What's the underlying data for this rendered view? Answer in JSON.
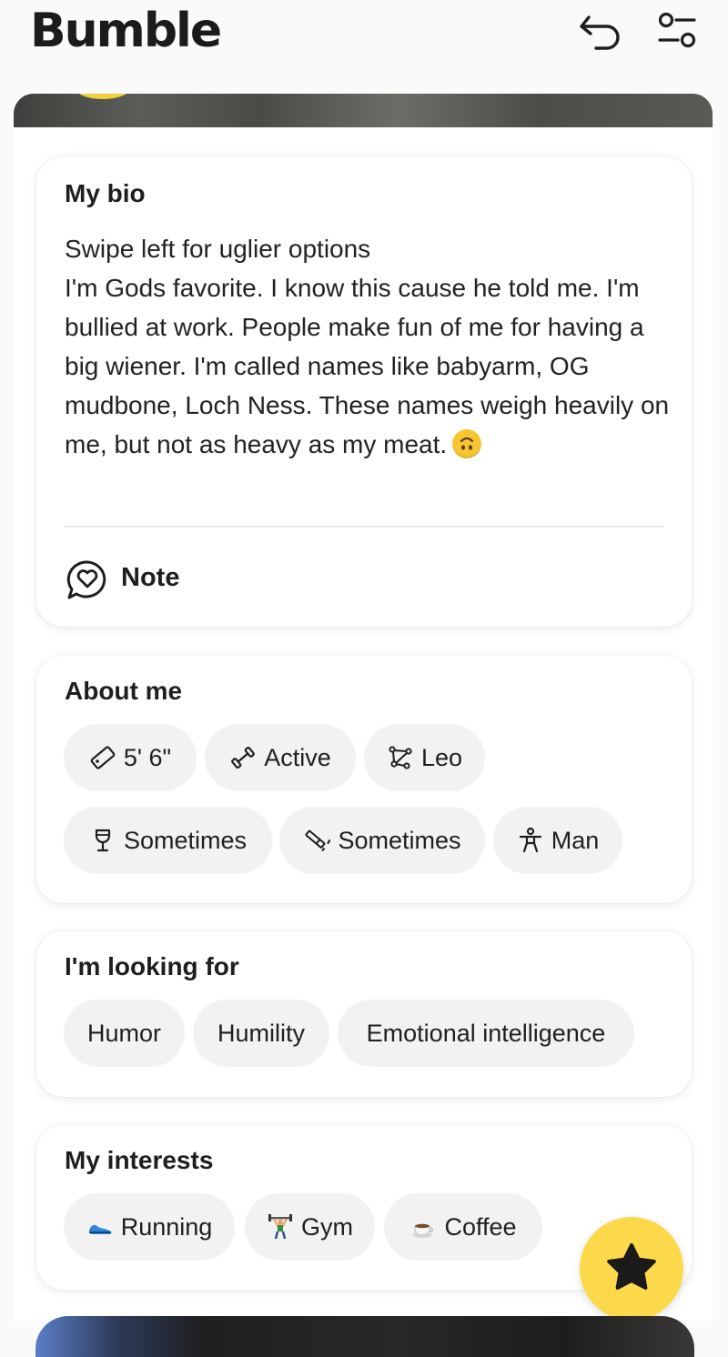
{
  "app": {
    "brand": "Bumble",
    "accent": "#fcd94a"
  },
  "header": {
    "undo_icon": "undo-icon",
    "filter_icon": "filter-sliders-icon"
  },
  "bio": {
    "title": "My bio",
    "text": "Swipe left for uglier options\nI'm Gods favorite. I know this cause he told me. I'm bullied at work. People make fun of me for having a big wiener. I'm called names like babyarm, OG mudbone, Loch Ness. These names weigh heavily on me, but not as heavy as my meat.",
    "emoji": "upside-down-face",
    "note_label": "Note"
  },
  "about": {
    "title": "About me",
    "chips": [
      {
        "label": "5' 6\"",
        "icon": "ruler-icon"
      },
      {
        "label": "Active",
        "icon": "dumbbell-icon"
      },
      {
        "label": "Leo",
        "icon": "zodiac-icon"
      },
      {
        "label": "Sometimes",
        "icon": "wine-glass-icon"
      },
      {
        "label": "Sometimes",
        "icon": "cigarette-icon"
      },
      {
        "label": "Man",
        "icon": "person-icon"
      }
    ]
  },
  "looking_for": {
    "title": "I'm looking for",
    "chips": [
      "Humor",
      "Humility",
      "Emotional intelligence"
    ]
  },
  "interests": {
    "title": "My interests",
    "chips": [
      {
        "label": "Running",
        "icon": "running-shoe-icon"
      },
      {
        "label": "Gym",
        "icon": "weightlifter-icon"
      },
      {
        "label": "Coffee",
        "icon": "coffee-cup-icon"
      }
    ]
  },
  "fab": {
    "icon": "star-icon"
  }
}
